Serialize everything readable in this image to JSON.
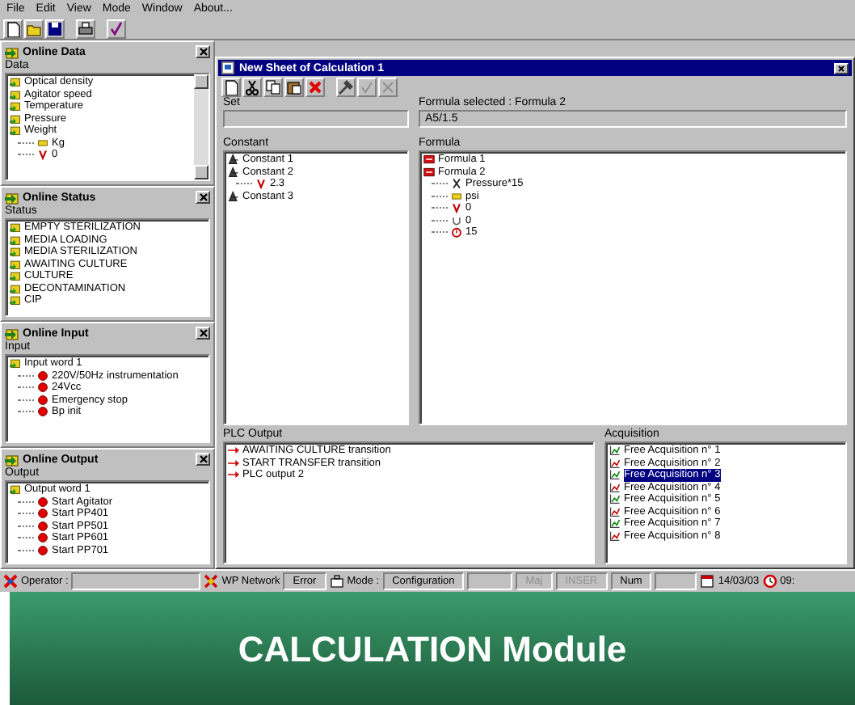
{
  "menu": [
    "File",
    "Edit",
    "View",
    "Mode",
    "Window",
    "About..."
  ],
  "panels": [
    {
      "title": "Online Data",
      "group": "Data",
      "scrollbar": true,
      "items": [
        {
          "label": "Optical density",
          "kind": "tag"
        },
        {
          "label": "Agitator speed",
          "kind": "tag"
        },
        {
          "label": "Temperature",
          "kind": "tag"
        },
        {
          "label": "Pressure",
          "kind": "tag"
        },
        {
          "label": "Weight",
          "kind": "tag",
          "children": [
            {
              "label": "Kg",
              "kind": "unit"
            },
            {
              "label": "0",
              "kind": "value"
            }
          ]
        }
      ]
    },
    {
      "title": "Online Status",
      "group": "Status",
      "scrollbar": false,
      "items": [
        {
          "label": "EMPTY STERILIZATION",
          "kind": "tag"
        },
        {
          "label": "MEDIA LOADING",
          "kind": "tag"
        },
        {
          "label": "MEDIA STERILIZATION",
          "kind": "tag"
        },
        {
          "label": "AWAITING CULTURE",
          "kind": "tag"
        },
        {
          "label": "CULTURE",
          "kind": "tag"
        },
        {
          "label": "DECONTAMINATION",
          "kind": "tag"
        },
        {
          "label": "CIP",
          "kind": "tag"
        }
      ]
    },
    {
      "title": "Online Input",
      "group": "Input",
      "scrollbar": false,
      "items": [
        {
          "label": "Input word 1",
          "kind": "tag",
          "children": [
            {
              "label": "220V/50Hz instrumentation",
              "kind": "dot"
            },
            {
              "label": "24Vcc",
              "kind": "dot"
            },
            {
              "label": "Emergency stop",
              "kind": "dot"
            },
            {
              "label": "Bp init",
              "kind": "dot"
            }
          ]
        }
      ]
    },
    {
      "title": "Online Output",
      "group": "Output",
      "scrollbar": false,
      "items": [
        {
          "label": "Output word 1",
          "kind": "tag",
          "children": [
            {
              "label": "Start Agitator",
              "kind": "dot"
            },
            {
              "label": "Start PP401",
              "kind": "dot"
            },
            {
              "label": "Start PP501",
              "kind": "dot"
            },
            {
              "label": "Start PP601",
              "kind": "dot"
            },
            {
              "label": "Start PP701",
              "kind": "dot"
            }
          ]
        }
      ]
    }
  ],
  "sheet": {
    "title": "New Sheet of Calculation 1",
    "set": {
      "label": "Set"
    },
    "formula_selected": {
      "label": "Formula selected : Formula 2",
      "value": "A5/1.5"
    },
    "constant": {
      "label": "Constant",
      "items": [
        {
          "label": "Constant 1",
          "kind": "constant"
        },
        {
          "label": "Constant 2",
          "kind": "constant",
          "children": [
            {
              "label": "2.3",
              "kind": "value"
            }
          ]
        },
        {
          "label": "Constant 3",
          "kind": "constant"
        }
      ]
    },
    "formula": {
      "label": "Formula",
      "items": [
        {
          "label": "Formula 1",
          "kind": "formula"
        },
        {
          "label": "Formula 2",
          "kind": "formula",
          "children": [
            {
              "label": "Pressure*15",
              "kind": "cross"
            },
            {
              "label": "psi",
              "kind": "unit"
            },
            {
              "label": "0",
              "kind": "value"
            },
            {
              "label": "0",
              "kind": "u"
            },
            {
              "label": "15",
              "kind": "alarm"
            }
          ]
        }
      ]
    },
    "plc_output": {
      "label": "PLC Output",
      "items": [
        {
          "label": "AWAITING CULTURE transition",
          "kind": "arrow"
        },
        {
          "label": "START TRANSFER transition",
          "kind": "arrow"
        },
        {
          "label": "PLC output 2",
          "kind": "arrow"
        }
      ]
    },
    "acquisition": {
      "label": "Acquisition",
      "items": [
        {
          "label": "Free Acquisition n° 1",
          "selected": false
        },
        {
          "label": "Free Acquisition n° 2",
          "selected": false
        },
        {
          "label": "Free Acquisition n° 3",
          "selected": true
        },
        {
          "label": "Free Acquisition n° 4",
          "selected": false
        },
        {
          "label": "Free Acquisition n° 5",
          "selected": false
        },
        {
          "label": "Free Acquisition n° 6",
          "selected": false
        },
        {
          "label": "Free Acquisition n° 7",
          "selected": false
        },
        {
          "label": "Free Acquisition n° 8",
          "selected": false
        }
      ]
    }
  },
  "status_bar": [
    {
      "kind": "icon",
      "text": "Operator :"
    },
    {
      "kind": "blank"
    },
    {
      "kind": "icon",
      "text": "WP Network"
    },
    {
      "kind": "field",
      "text": "Error",
      "disabled": false
    },
    {
      "kind": "icon",
      "text": "Mode :"
    },
    {
      "kind": "field",
      "text": "Configuration",
      "disabled": false
    },
    {
      "kind": "blank"
    },
    {
      "kind": "field",
      "text": "Maj",
      "disabled": true
    },
    {
      "kind": "field",
      "text": "INSER",
      "disabled": true
    },
    {
      "kind": "field",
      "text": "Num",
      "disabled": false
    },
    {
      "kind": "blank"
    },
    {
      "kind": "icon",
      "text": "14/03/03"
    },
    {
      "kind": "icon",
      "text": "09:"
    }
  ],
  "caption": "CALCULATION Module"
}
